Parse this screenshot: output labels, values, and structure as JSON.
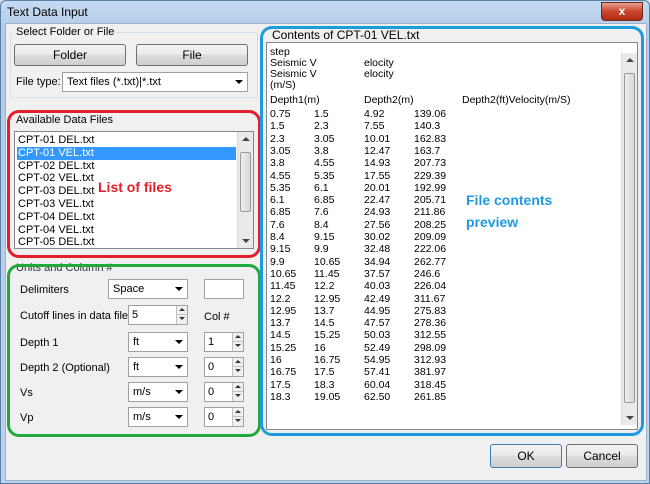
{
  "window": {
    "title": "Text Data Input",
    "close_label": "x"
  },
  "select_group": {
    "label": "Select Folder or File",
    "folder_button": "Folder",
    "file_button": "File",
    "file_type_label": "File type:",
    "file_type_value": "Text files (*.txt)|*.txt"
  },
  "available_files": {
    "label": "Available Data Files",
    "items": [
      "CPT-01 DEL.txt",
      "CPT-01 VEL.txt",
      "CPT-02 DEL.txt",
      "CPT-02 VEL.txt",
      "CPT-03 DEL.txt",
      "CPT-03 VEL.txt",
      "CPT-04 DEL.txt",
      "CPT-04 VEL.txt",
      "CPT-05 DEL.txt"
    ],
    "selected_index": 1
  },
  "units_group": {
    "label": "Units and Column #",
    "delimiters_label": "Delimiters",
    "delimiters_value": "Space",
    "cutoff_label": "Cutoff lines in data file",
    "cutoff_value": "5",
    "col_header": "Col #",
    "rows": [
      {
        "label": "Depth 1",
        "unit": "ft",
        "col": "1"
      },
      {
        "label": "Depth 2 (Optional)",
        "unit": "ft",
        "col": "0"
      },
      {
        "label": "Vs",
        "unit": "m/s",
        "col": "0"
      },
      {
        "label": "Vp",
        "unit": "m/s",
        "col": "0"
      }
    ]
  },
  "preview": {
    "label": "Contents of CPT-01 VEL.txt",
    "header_lines": [
      [
        "step",
        ""
      ],
      [
        "Seismic V",
        "elocity"
      ],
      [
        "Seismic V",
        "elocity"
      ],
      [
        "(m/S)",
        ""
      ]
    ],
    "col_headers": [
      "Depth1(m)",
      "Depth2(m)",
      "Depth2(ft)Velocity(m/S)"
    ],
    "rows": [
      [
        "0.75",
        "1.5",
        "4.92",
        "139.06"
      ],
      [
        "1.5",
        "2.3",
        "7.55",
        "140.3"
      ],
      [
        "2.3",
        "3.05",
        "10.01",
        "162.83"
      ],
      [
        "3.05",
        "3.8",
        "12.47",
        "163.7"
      ],
      [
        "3.8",
        "4.55",
        "14.93",
        "207.73"
      ],
      [
        "4.55",
        "5.35",
        "17.55",
        "229.39"
      ],
      [
        "5.35",
        "6.1",
        "20.01",
        "192.99"
      ],
      [
        "6.1",
        "6.85",
        "22.47",
        "205.71"
      ],
      [
        "6.85",
        "7.6",
        "24.93",
        "211.86"
      ],
      [
        "7.6",
        "8.4",
        "27.56",
        "208.25"
      ],
      [
        "8.4",
        "9.15",
        "30.02",
        "209.09"
      ],
      [
        "9.15",
        "9.9",
        "32.48",
        "222.06"
      ],
      [
        "9.9",
        "10.65",
        "34.94",
        "262.77"
      ],
      [
        "10.65",
        "11.45",
        "37.57",
        "246.6"
      ],
      [
        "11.45",
        "12.2",
        "40.03",
        "226.04"
      ],
      [
        "12.2",
        "12.95",
        "42.49",
        "311.67"
      ],
      [
        "12.95",
        "13.7",
        "44.95",
        "275.83"
      ],
      [
        "13.7",
        "14.5",
        "47.57",
        "278.36"
      ],
      [
        "14.5",
        "15.25",
        "50.03",
        "312.55"
      ],
      [
        "15.25",
        "16",
        "52.49",
        "298.09"
      ],
      [
        "16",
        "16.75",
        "54.95",
        "312.93"
      ],
      [
        "16.75",
        "17.5",
        "57.41",
        "381.97"
      ],
      [
        "17.5",
        "18.3",
        "60.04",
        "318.45"
      ],
      [
        "18.3",
        "19.05",
        "62.50",
        "261.85"
      ]
    ]
  },
  "annotations": {
    "list_label": "List of files",
    "preview_label_1": "File contents",
    "preview_label_2": "preview",
    "red": "#e0202a",
    "green": "#22a83a",
    "blue": "#1e9be0",
    "preview_color": "#1e9be0"
  },
  "footer": {
    "ok": "OK",
    "cancel": "Cancel"
  }
}
